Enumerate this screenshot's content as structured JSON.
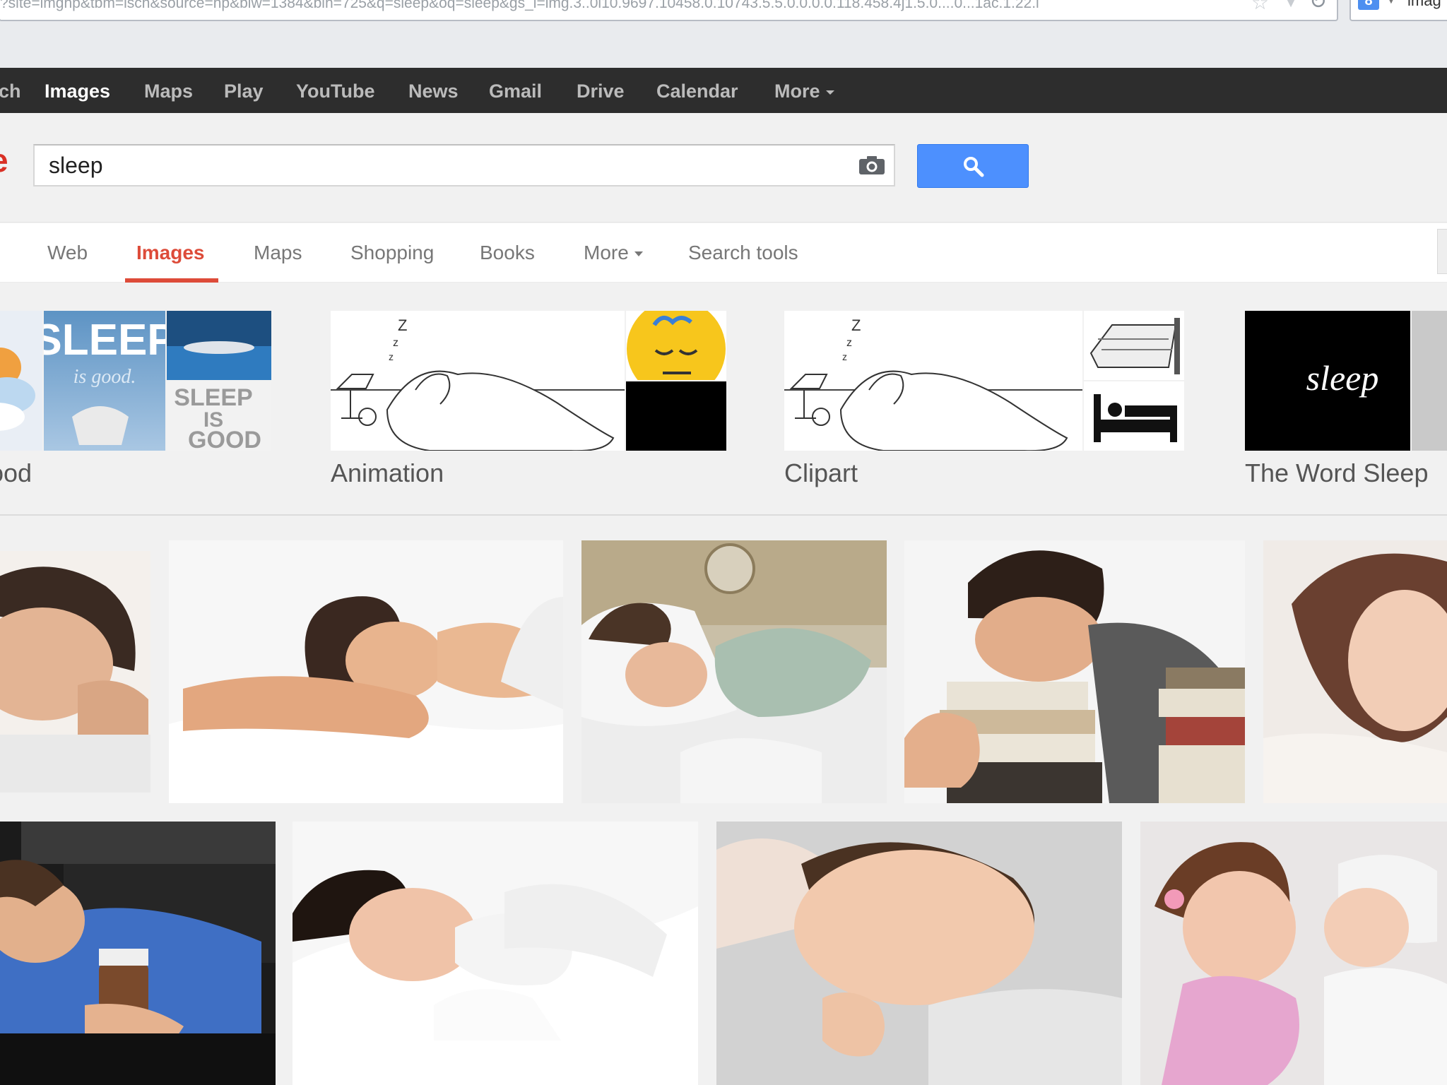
{
  "browser": {
    "url": "?site=imghp&tbm=isch&source=hp&biw=1384&bih=725&q=sleep&oq=sleep&gs_l=img.3..0l10.9697.10458.0.10743.5.5.0.0.0.0.118.458.4j1.5.0....0...1ac.1.22.i",
    "search_engine_text": "imag",
    "search_engine_badge": "8",
    "icons": [
      "star-icon",
      "dropdown-icon",
      "reload-icon"
    ]
  },
  "gbar": {
    "items": [
      {
        "label": "ch",
        "active": false
      },
      {
        "label": "Images",
        "active": true
      },
      {
        "label": "Maps",
        "active": false
      },
      {
        "label": "Play",
        "active": false
      },
      {
        "label": "YouTube",
        "active": false
      },
      {
        "label": "News",
        "active": false
      },
      {
        "label": "Gmail",
        "active": false
      },
      {
        "label": "Drive",
        "active": false
      },
      {
        "label": "Calendar",
        "active": false
      },
      {
        "label": "More",
        "active": false
      }
    ]
  },
  "search": {
    "logo_fragment": "e",
    "query": "sleep",
    "icons": [
      "camera-icon",
      "search-icon"
    ],
    "button_color": "#4d90fe"
  },
  "tabs": {
    "items": [
      {
        "label": "Web",
        "active": false
      },
      {
        "label": "Images",
        "active": true
      },
      {
        "label": "Maps",
        "active": false
      },
      {
        "label": "Shopping",
        "active": false
      },
      {
        "label": "Books",
        "active": false
      },
      {
        "label": "More",
        "active": false
      },
      {
        "label": "Search tools",
        "active": false
      }
    ],
    "active_color": "#dd4b39"
  },
  "related": {
    "groups": [
      {
        "label": "ood",
        "thumb_texts": [
          "SLEEP",
          "is good.",
          "SLEEP",
          "IS",
          "GOOD"
        ]
      },
      {
        "label": "Animation",
        "thumb_texts": [
          "Z",
          "z",
          "z"
        ]
      },
      {
        "label": "Clipart",
        "thumb_texts": [
          "Z",
          "z",
          "z"
        ]
      },
      {
        "label": "The Word Sleep",
        "thumb_texts": [
          "sleep"
        ]
      }
    ]
  },
  "results": {
    "row1": [
      "man sleeping on pillow",
      "woman sleeping on bed",
      "woman sleeping with clock",
      "man asleep on books",
      "girl sleeping"
    ],
    "row2": [
      "man asleep at desk with coffee",
      "woman sleeping under duvet",
      "baby sleeping",
      "children sleeping"
    ]
  }
}
